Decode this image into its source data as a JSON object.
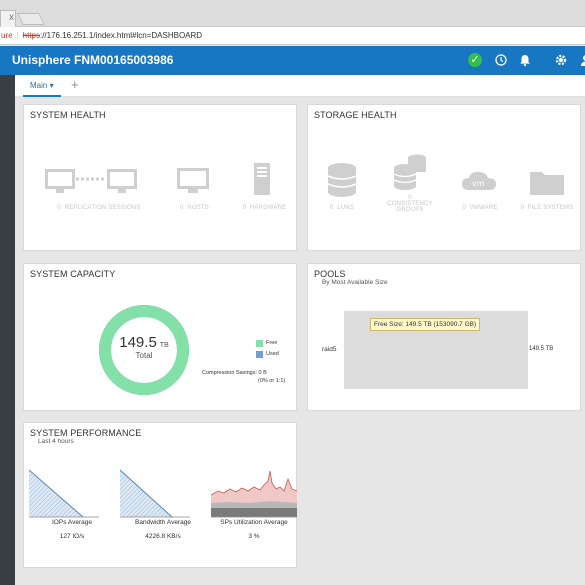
{
  "browser": {
    "tab_close": "x",
    "insecure": "ure",
    "url_https": "https",
    "url_rest": "://176.16.251.1/index.html#lcn=DASHBOARD"
  },
  "app": {
    "title": "Unisphere FNM00165003986",
    "tab_main": "Main",
    "tab_main_caret": "▾",
    "tab_add": "+",
    "colors": {
      "brand": "#1777c2",
      "ok": "#31c04c",
      "free": "#82e0a8",
      "used": "#6f9fd2"
    }
  },
  "system_health": {
    "title": "SYSTEM HEALTH",
    "items": [
      {
        "count": "0",
        "label": "REPLICATION SESSIONS",
        "icon": "replication-icon"
      },
      {
        "count": "0",
        "label": "HOSTS",
        "icon": "host-icon"
      },
      {
        "count": "0",
        "label": "HARDWARE",
        "icon": "hardware-icon"
      }
    ]
  },
  "storage_health": {
    "title": "STORAGE HEALTH",
    "items": [
      {
        "count": "0",
        "label": "LUNS",
        "icon": "lun-icon"
      },
      {
        "count": "0",
        "label": "CONSISTENCY",
        "label2": "GROUPS",
        "icon": "consistency-groups-icon"
      },
      {
        "count": "0",
        "label": "VMWARE",
        "icon": "vmware-icon"
      },
      {
        "count": "0",
        "label": "FILE SYSTEMS",
        "icon": "folder-icon"
      }
    ]
  },
  "system_capacity": {
    "title": "SYSTEM CAPACITY",
    "total_value": "149.5",
    "total_unit": "TB",
    "total_label": "Total",
    "legend_free": "Free",
    "legend_used": "Used",
    "compression": "Compression Savings:  0 B",
    "compression_pct": "(0% or 1:1)",
    "free_fraction": 1.0
  },
  "pools": {
    "title": "POOLS",
    "subtitle": "By Most Available Size",
    "pool_name": "raid5",
    "pool_size": "149.5 TB",
    "tooltip": "Free Size: 149.5 TB (153090.7 GB)"
  },
  "system_performance": {
    "title": "SYSTEM PERFORMANCE",
    "subtitle": "Last 4 hours",
    "metrics": [
      {
        "label": "IOPs Average",
        "value": "127 IO/s"
      },
      {
        "label": "Bandwidth Average",
        "value": "4226.8 KB/s"
      },
      {
        "label": "SPs Utilization Average",
        "value": "3 %"
      }
    ]
  }
}
